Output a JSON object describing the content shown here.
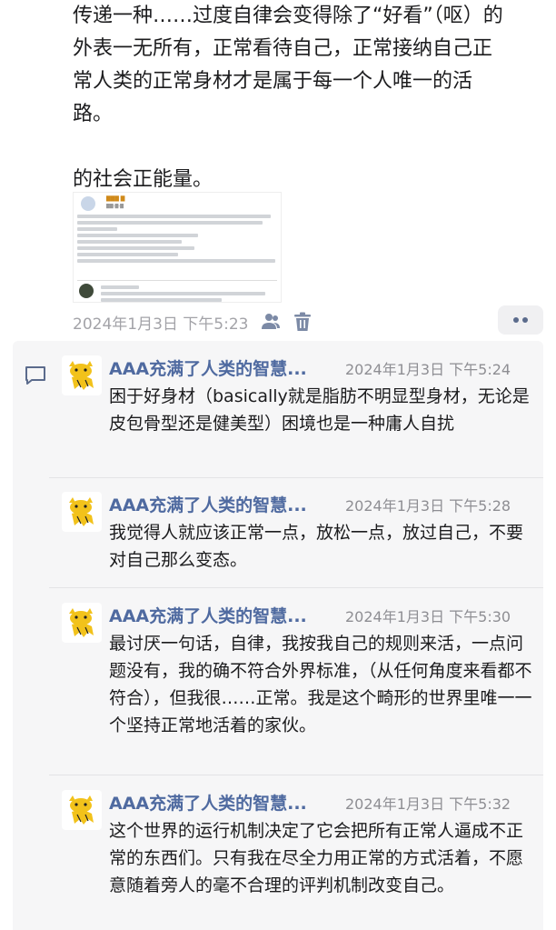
{
  "post": {
    "lines": [
      "传递一种……过度自律会变得除了“好看”（呕）的",
      "外表一无所有，正常看待自己，正常接纳自己正",
      "常人类的正常身材才是属于每一个人唯一的活",
      "路。"
    ],
    "line_after_gap": "的社会正能量。",
    "timestamp": "2024年1月3日 下午5:23",
    "icons": [
      "people-icon",
      "trash-icon",
      "more-icon"
    ]
  },
  "comments": [
    {
      "name": "AAA充满了人类的智慧...",
      "time": "2024年1月3日 下午5:24",
      "text": "困于好身材（basically就是脂肪不明显型身材，无论是皮包骨型还是健美型）困境也是一种庸人自扰"
    },
    {
      "name": "AAA充满了人类的智慧...",
      "time": "2024年1月3日 下午5:28",
      "text": "我觉得人就应该正常一点，放松一点，放过自己，不要对自己那么变态。"
    },
    {
      "name": "AAA充满了人类的智慧...",
      "time": "2024年1月3日 下午5:30",
      "text": "最讨厌一句话，自律，我按我自己的规则来活，一点问题没有，我的确不符合外界标准，（从任何角度来看都不符合），但我很……正常。我是这个畸形的世界里唯一一个坚持正常地活着的家伙。"
    },
    {
      "name": "AAA充满了人类的智慧...",
      "time": "2024年1月3日 下午5:32",
      "text": "这个世界的运行机制决定了它会把所有正常人逼成不正常的东西们。只有我在尽全力用正常的方式活着，不愿意随着旁人的毫不合理的评判机制改变自己。"
    }
  ],
  "colors": {
    "name": "#4f6aa0",
    "meta": "#a3a3a8",
    "comment_bg": "#f6f6f7",
    "avatar_yellow": "#f2c21b"
  }
}
